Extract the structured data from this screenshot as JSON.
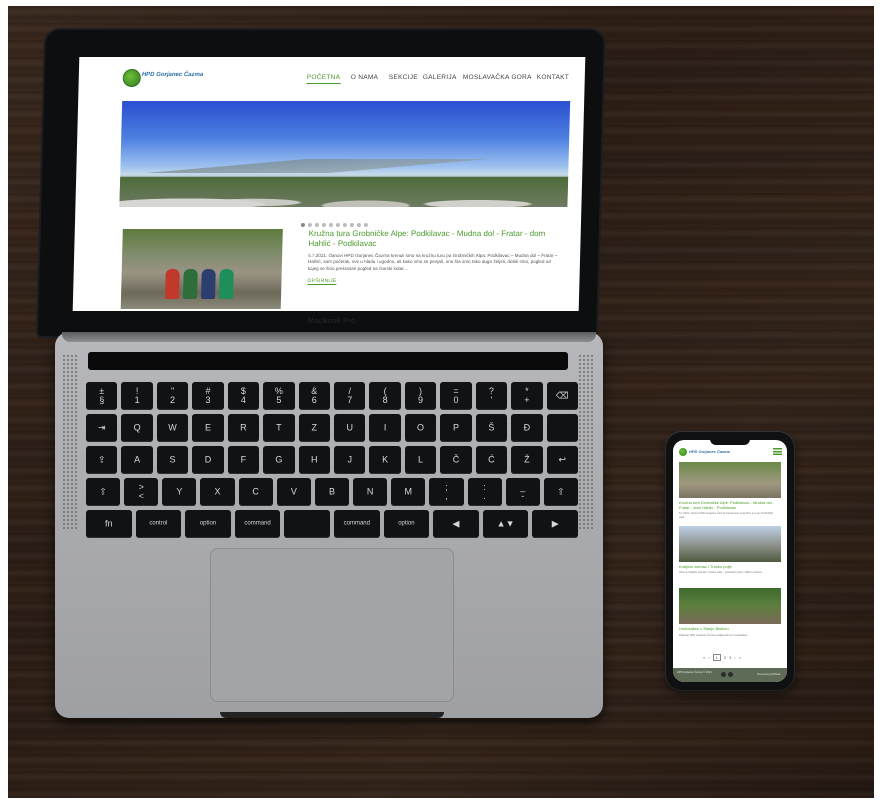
{
  "laptop": {
    "brand": "MacBook Pro",
    "website": {
      "logo_text": "HPD Gorjanec Čazma",
      "nav": [
        {
          "label": "POČETNA",
          "active": true
        },
        {
          "label": "O NAMA",
          "active": false
        },
        {
          "label": "SEKCIJE",
          "active": false
        },
        {
          "label": "GALERIJA",
          "active": false
        },
        {
          "label": "MOSLAVAČKA GORA",
          "active": false
        },
        {
          "label": "KONTAKT",
          "active": false
        }
      ],
      "slider_dots": 10,
      "slider_active_index": 0,
      "post": {
        "title": "Kružna tura Grobničke Alpe: Podkilavac - Mudna dol - Fratar - dom Hahlić - Podkilavac",
        "excerpt": "5.7.2021. članovi HPD Gorjanec Čazma krenuli smo na kružnu turu po Grobničkih Alpa: Podkilavac – Mudna dol – Fratar – Hahlić, sam početak, sve u hladu i ugodno, ali kako smo se penjali, ono šta smo tako dugo željeli, dobili smo, pogled od kojeg se širio prekrasan pogled na Gorski kotar…",
        "more_label": "OPŠIRNIJE"
      }
    },
    "keyboard": {
      "row1": [
        "±\n§",
        "!\n1",
        "\"\n2",
        "#\n3",
        "$\n4",
        "%\n5",
        "&\n6",
        "/\n7",
        "(\n8",
        ")\n9",
        "=\n0",
        "?\n'",
        "*\n+",
        "⌫"
      ],
      "row2": [
        "⇥",
        "Q",
        "W",
        "E",
        "R",
        "T",
        "Z",
        "U",
        "I",
        "O",
        "P",
        "Š",
        "Đ",
        ""
      ],
      "row3": [
        "⇪",
        "A",
        "S",
        "D",
        "F",
        "G",
        "H",
        "J",
        "K",
        "L",
        "Č",
        "Ć",
        "Ž",
        "↩"
      ],
      "row4": [
        "⇧",
        ">\n<",
        "Y",
        "X",
        "C",
        "V",
        "B",
        "N",
        "M",
        ";\n,",
        ":\n.",
        "_\n-",
        "⇧"
      ],
      "row5": [
        "fn",
        "control",
        "option",
        "command",
        "",
        "command",
        "option",
        "◀",
        "▲▼",
        "▶"
      ]
    }
  },
  "phone": {
    "logo_text": "HPD Gorjanec Čazma",
    "posts": [
      {
        "title": "Kružna tura Grobničke Alpe: Podkilavac - Mudna dol - Fratar - dom Hahlić - Podkilavac",
        "excerpt": "5.7.2021. članovi HPD Gorjanec Čazma krenuli smo na kružnu turu po Grobničkih Alpa…"
      },
      {
        "title": "Kraljičin zdenac i Tursko polje",
        "excerpt": "Izlet na Kraljičin zdenac i Tursko polje – prekrasno jutro i odlično društvo…"
      },
      {
        "title": "Hodočašće u Mariju Bistricu",
        "excerpt": "Planinari HPD Gorjanec Čazma sudjelovali su u hodočašću…"
      }
    ],
    "pager": [
      "«",
      "‹",
      "1",
      "2",
      "3",
      "›",
      "»"
    ],
    "pager_current": "1",
    "footer_left": "HPD Gorjanec Čazma © 2021",
    "footer_right": "Sva prava pridržana"
  }
}
